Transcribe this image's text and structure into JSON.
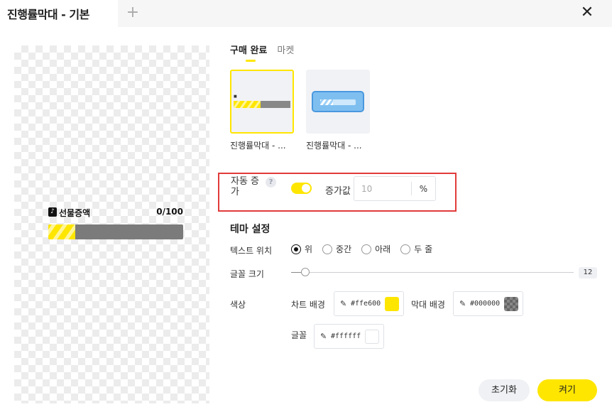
{
  "window": {
    "tab_title": "진행률막대 - 기본",
    "add_tab_icon": "plus-icon",
    "close_icon": "close-icon"
  },
  "preview": {
    "platform_icon": "tiktok-icon",
    "label": "선물증액",
    "count": "0/100",
    "progress": 0.2
  },
  "tabs": [
    {
      "label": "구매 완료",
      "active": true
    },
    {
      "label": "마켓",
      "active": false
    }
  ],
  "templates": [
    {
      "name": "진행률막대 - ...",
      "selected": true
    },
    {
      "name": "진행률막대 - ...",
      "selected": false
    }
  ],
  "auto_increment": {
    "label": "자동 증가",
    "help_icon": "question-icon",
    "enabled": true,
    "increment_label": "증가값",
    "increment_placeholder": "10",
    "increment_unit": "%"
  },
  "theme": {
    "title": "테마 설정",
    "text_position": {
      "label": "텍스트 위치",
      "options": [
        "위",
        "중간",
        "아래",
        "두 줄"
      ],
      "selected": "위"
    },
    "font_size": {
      "label": "글꼴 크기",
      "value": "12",
      "fraction": 0.05
    },
    "colors": {
      "label": "색상",
      "chart_bg_label": "차트 배경",
      "chart_bg_hex": "#ffe600",
      "bar_bg_label": "막대 배경",
      "bar_bg_hex": "#000000",
      "font_label": "글꼴",
      "font_hex": "#ffffff",
      "picker_icon": "eyedropper-icon"
    }
  },
  "buttons": {
    "reset": "초기화",
    "apply": "켜기"
  }
}
